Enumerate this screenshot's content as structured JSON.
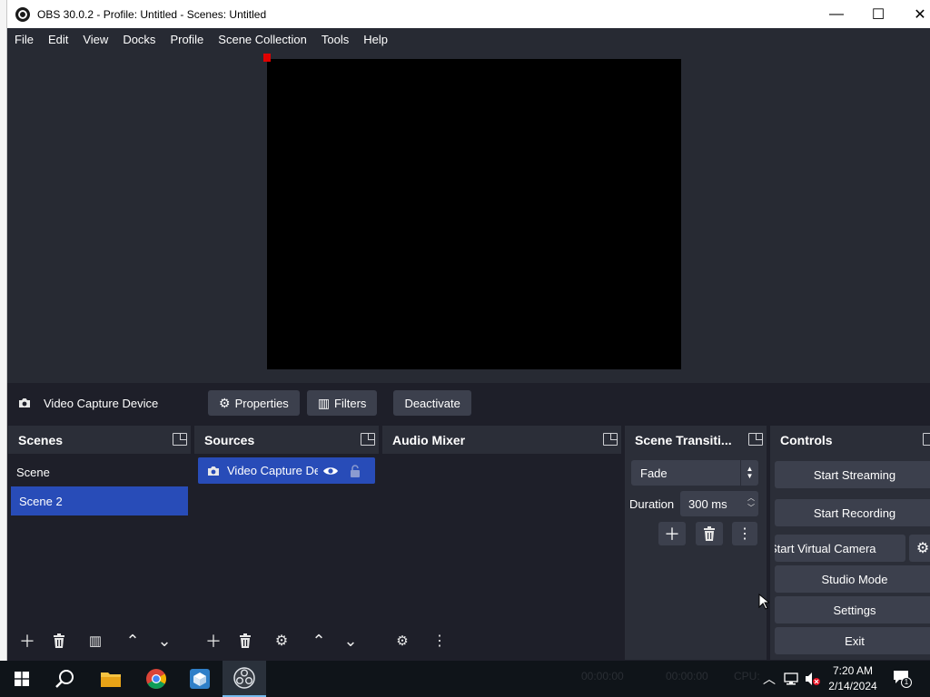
{
  "window": {
    "title": "OBS 30.0.2 - Profile: Untitled - Scenes: Untitled",
    "minimize_glyph": "—",
    "maximize_glyph": "☐",
    "close_glyph": "✕"
  },
  "menu": [
    "File",
    "Edit",
    "View",
    "Docks",
    "Profile",
    "Scene Collection",
    "Tools",
    "Help"
  ],
  "source_toolbar": {
    "selected_source": "Video Capture Device",
    "properties_label": "Properties",
    "filters_label": "Filters",
    "deactivate_label": "Deactivate"
  },
  "scenes": {
    "title": "Scenes",
    "items": [
      "Scene",
      "Scene 2"
    ],
    "selected": "Scene 2"
  },
  "sources": {
    "title": "Sources",
    "items": [
      {
        "name": "Video Capture De",
        "visible": true,
        "locked": false
      }
    ]
  },
  "audio_mixer": {
    "title": "Audio Mixer"
  },
  "transitions": {
    "title": "Scene Transiti...",
    "selected": "Fade",
    "duration_label": "Duration",
    "duration_value": "300 ms"
  },
  "controls": {
    "title": "Controls",
    "start_streaming": "Start Streaming",
    "start_recording": "Start Recording",
    "start_virtual_camera": "Start Virtual Camera",
    "studio_mode": "Studio Mode",
    "settings": "Settings",
    "exit": "Exit"
  },
  "status_bar_faint": {
    "rec": "00:00:00",
    "fps": "00:00:00",
    "cpu": "CPU:"
  },
  "taskbar": {
    "apps": [
      "start",
      "search",
      "file-explorer",
      "chrome",
      "virtualbox",
      "obs"
    ],
    "active_app": "obs",
    "clock_time": "7:20 AM",
    "clock_date": "2/14/2024",
    "notification_count": "1"
  },
  "colors": {
    "selection": "#284cb8",
    "dock_bg": "#2b2e38",
    "button_bg": "#3c404d",
    "window_bg": "#1e1f29",
    "preview_bg": "#272a33",
    "taskbar_bg": "#0f1419"
  }
}
